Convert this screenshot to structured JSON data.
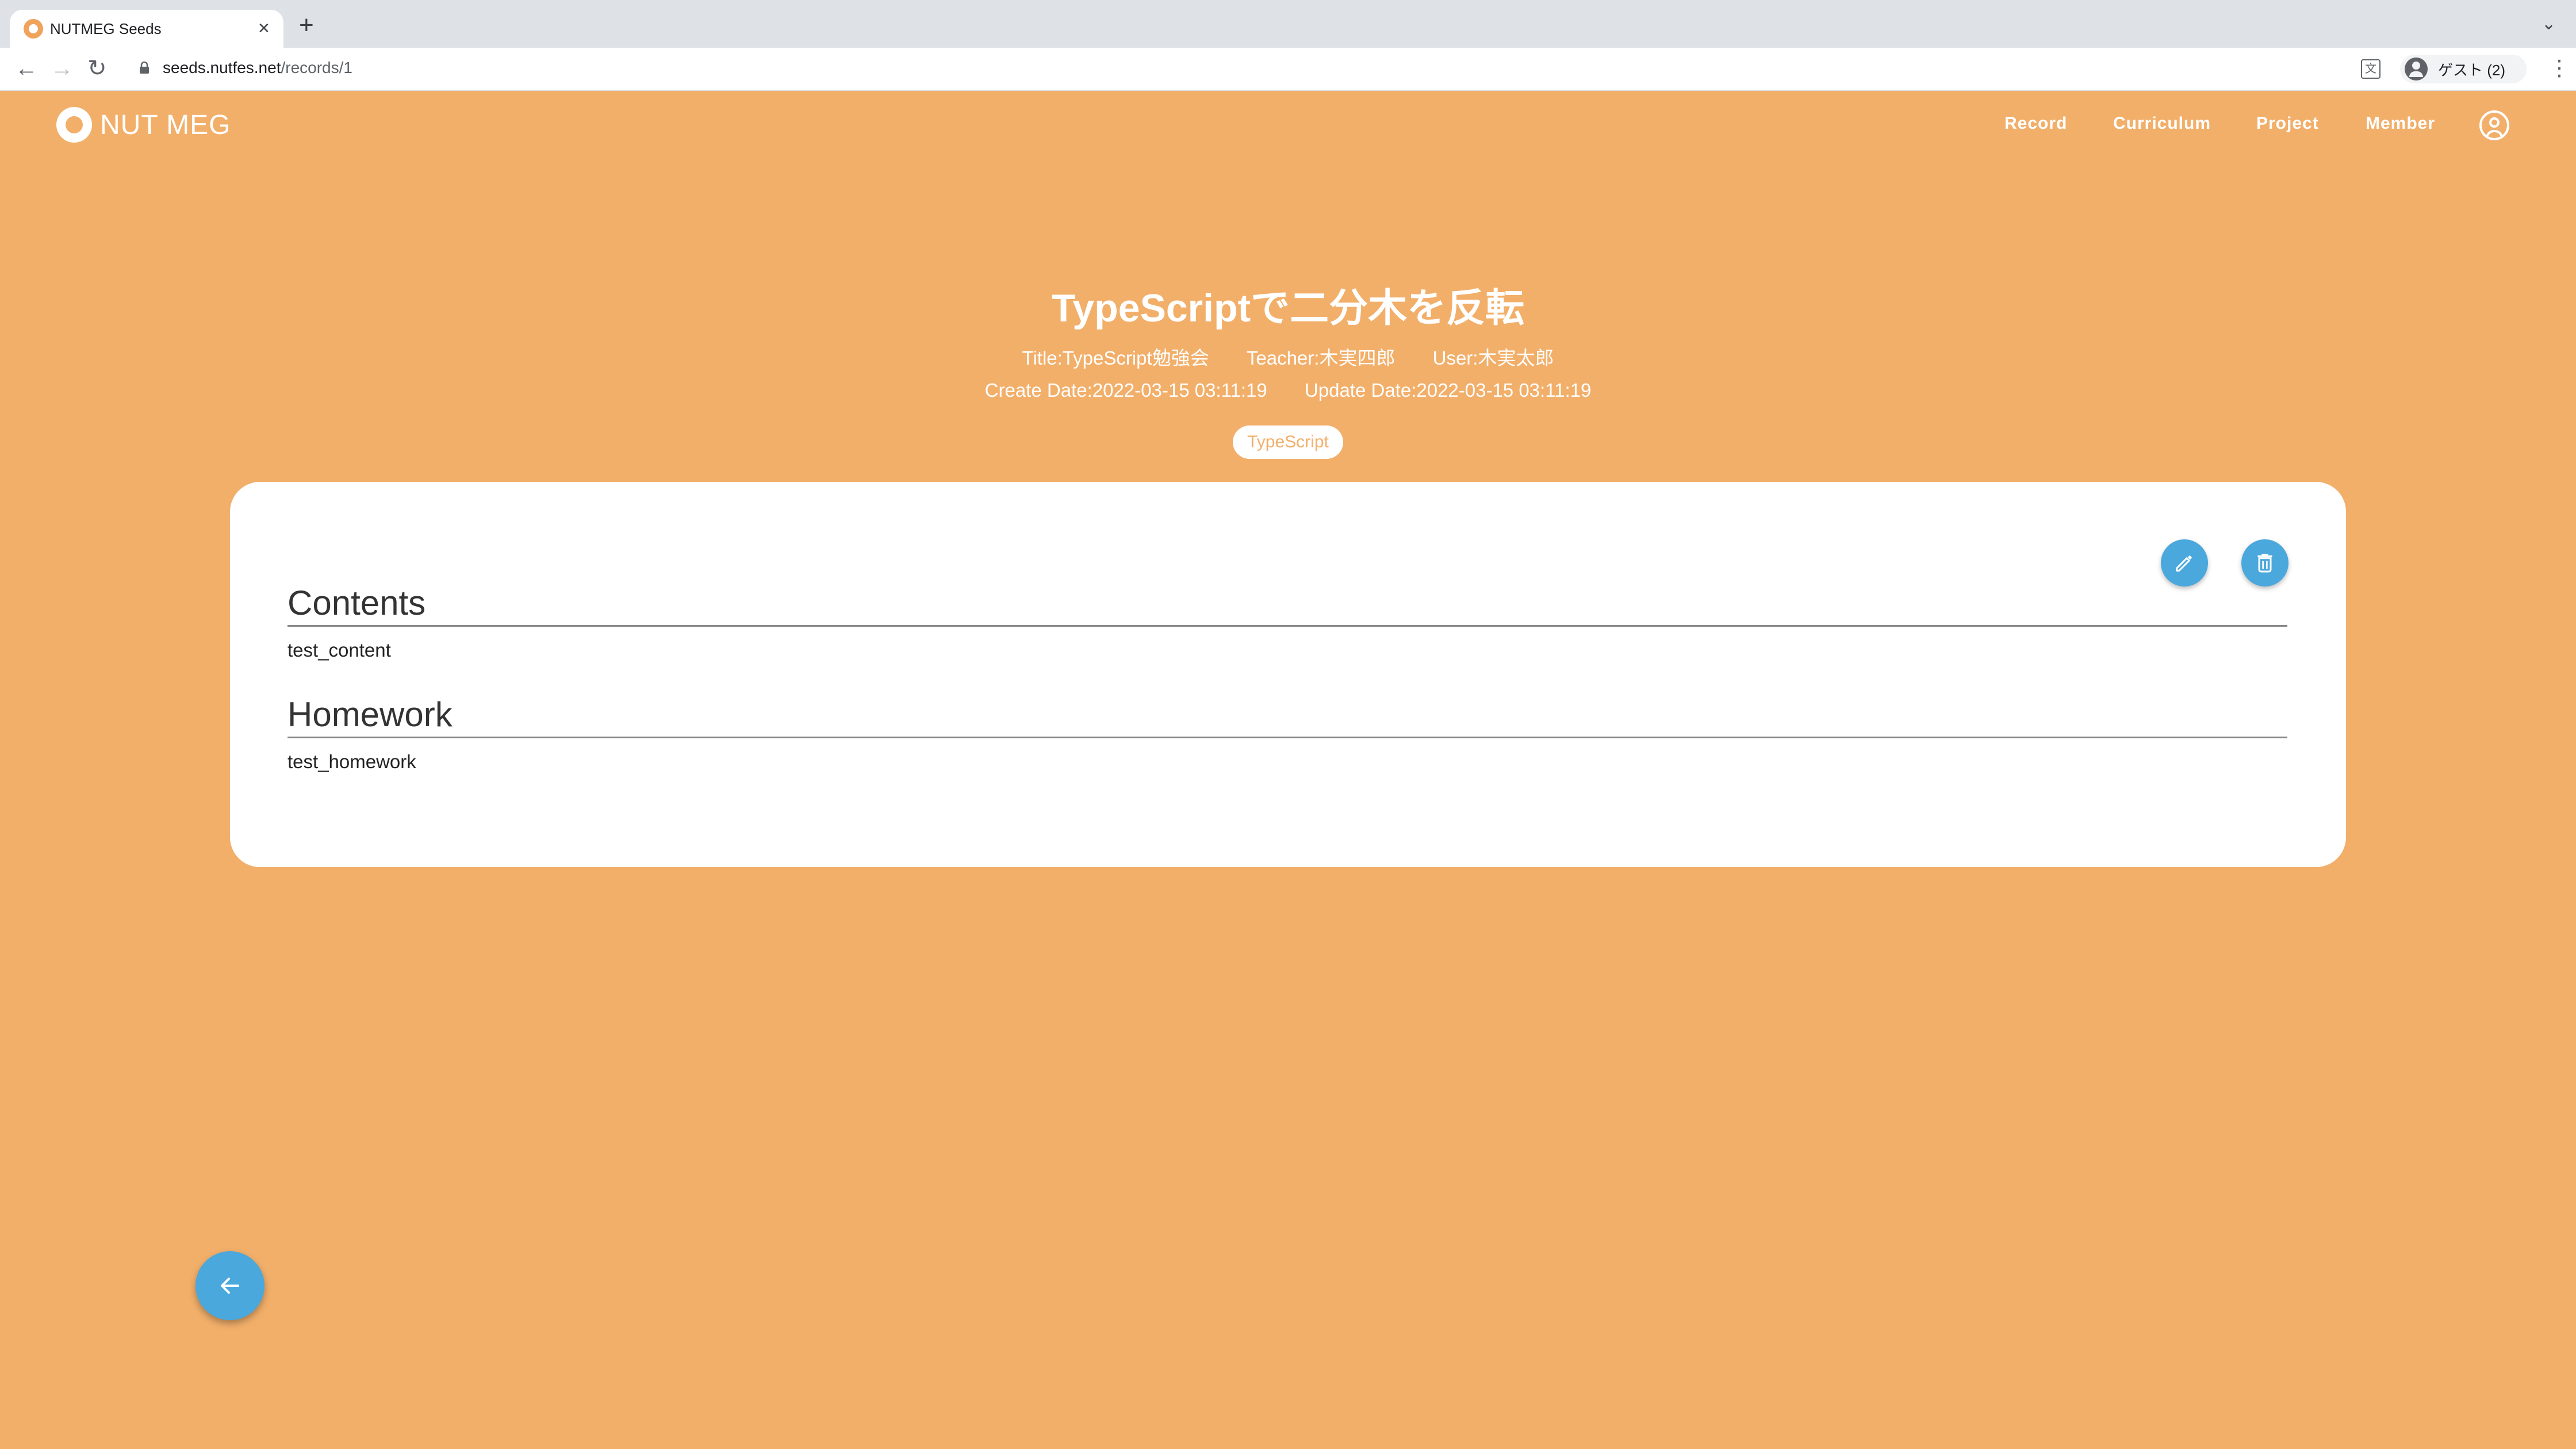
{
  "browser": {
    "tab_title": "NUTMEG Seeds",
    "tab_close": "×",
    "new_tab": "+",
    "tab_menu": "⌄",
    "url_host": "seeds.nutfes.net",
    "url_path": "/records/1",
    "profile_label": "ゲスト (2)",
    "back": "←",
    "forward": "→",
    "reload": "↻",
    "translate": "文",
    "menu": "⋮"
  },
  "site": {
    "logo_text": "NUT MEG",
    "nav": [
      "Record",
      "Curriculum",
      "Project",
      "Member"
    ]
  },
  "record": {
    "title": "TypeScriptで二分木を反転",
    "meta_title": "Title:TypeScript勉強会",
    "meta_teacher": "Teacher:木実四郎",
    "meta_user": "User:木実太郎",
    "create_date": "Create Date:2022-03-15 03:11:19",
    "update_date": "Update Date:2022-03-15 03:11:19",
    "tag": "TypeScript"
  },
  "card": {
    "contents_heading": "Contents",
    "contents_body": "test_content",
    "homework_heading": "Homework",
    "homework_body": "test_homework"
  },
  "icons": {
    "edit": "pencil-icon",
    "delete": "trash-icon",
    "back": "arrow-left-icon"
  },
  "colors": {
    "page_background": "#f2af6a",
    "action_button": "#4aa8dd"
  }
}
